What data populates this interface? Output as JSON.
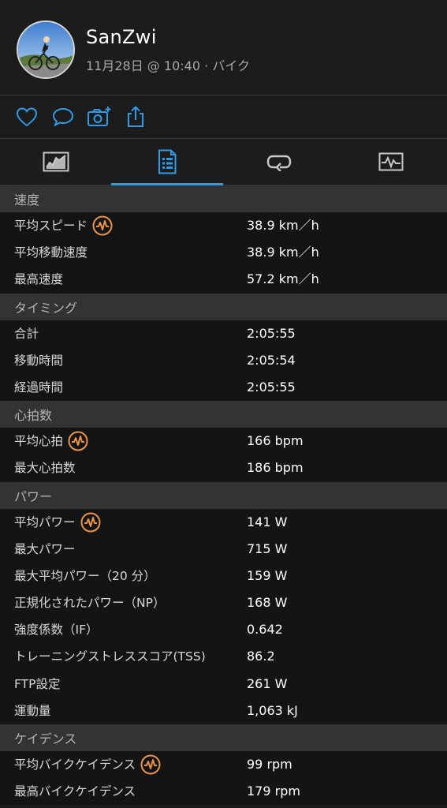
{
  "profile": {
    "name": "SanZwi",
    "meta": "11月28日 @ 10:40 · バイク"
  },
  "actions": [
    "like-icon",
    "comment-icon",
    "add-photo-icon",
    "share-icon"
  ],
  "tabs": [
    "overview-icon",
    "stats-icon",
    "laps-icon",
    "charts-icon"
  ],
  "selected_tab": 1,
  "accent_color": "#2f9be6",
  "badge_color": "#e8944a",
  "sections": [
    {
      "title": "速度",
      "rows": [
        {
          "label": "平均スピード",
          "value": "38.9 km／h",
          "badge": true
        },
        {
          "label": "平均移動速度",
          "value": "38.9 km／h",
          "badge": false
        },
        {
          "label": "最高速度",
          "value": "57.2 km／h",
          "badge": false
        }
      ]
    },
    {
      "title": "タイミング",
      "rows": [
        {
          "label": "合計",
          "value": "2:05:55",
          "badge": false
        },
        {
          "label": "移動時間",
          "value": "2:05:54",
          "badge": false
        },
        {
          "label": "経過時間",
          "value": "2:05:55",
          "badge": false
        }
      ]
    },
    {
      "title": "心拍数",
      "rows": [
        {
          "label": "平均心拍",
          "value": "166 bpm",
          "badge": true
        },
        {
          "label": "最大心拍数",
          "value": "186 bpm",
          "badge": false
        }
      ]
    },
    {
      "title": "パワー",
      "rows": [
        {
          "label": "平均パワー",
          "value": "141 W",
          "badge": true
        },
        {
          "label": "最大パワー",
          "value": "715 W",
          "badge": false
        },
        {
          "label": "最大平均パワー（20 分）",
          "value": "159 W",
          "badge": false
        },
        {
          "label": "正規化されたパワー（NP）",
          "value": "168 W",
          "badge": false
        },
        {
          "label": "強度係数（IF）",
          "value": "0.642",
          "badge": false
        },
        {
          "label": "トレーニングストレススコア(TSS)",
          "value": "86.2",
          "badge": false
        },
        {
          "label": "FTP設定",
          "value": "261 W",
          "badge": false
        },
        {
          "label": "運動量",
          "value": "1,063 kJ",
          "badge": false
        }
      ]
    },
    {
      "title": "ケイデンス",
      "rows": [
        {
          "label": "平均バイクケイデンス",
          "value": "99 rpm",
          "badge": true
        },
        {
          "label": "最高バイクケイデンス",
          "value": "179 rpm",
          "badge": false
        }
      ]
    }
  ]
}
